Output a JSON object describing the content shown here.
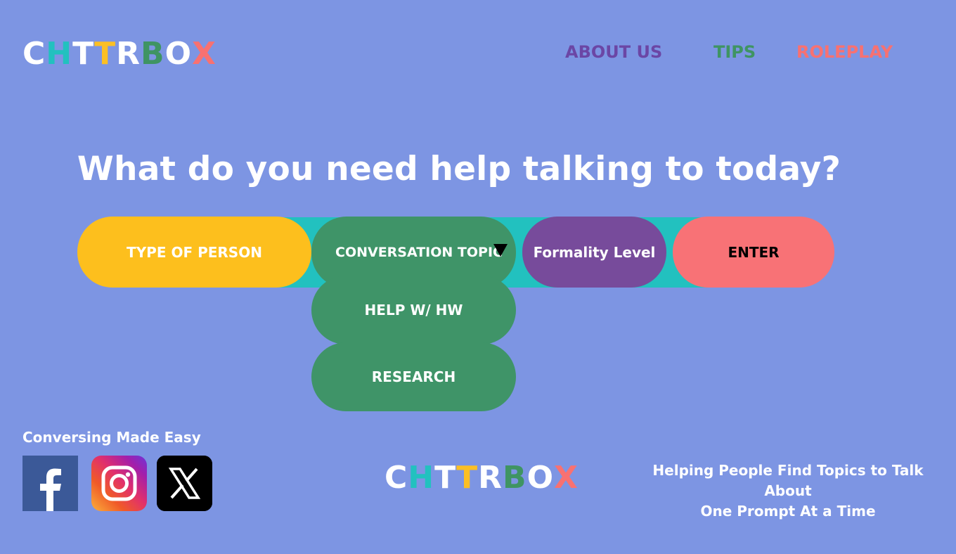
{
  "header": {
    "logo_letters": [
      {
        "char": "C",
        "color": "#ffffff"
      },
      {
        "char": "H",
        "color": "#22c1bf"
      },
      {
        "char": "T",
        "color": "#ffffff"
      },
      {
        "char": "T",
        "color": "#fbbf24"
      },
      {
        "char": "R",
        "color": "#ffffff"
      },
      {
        "char": "B",
        "color": "#3f9463"
      },
      {
        "char": "O",
        "color": "#ffffff"
      },
      {
        "char": "X",
        "color": "#f87171"
      }
    ],
    "nav": [
      {
        "label": "ABOUT US",
        "color": "#6b46a5"
      },
      {
        "label": "TIPS",
        "color": "#3f9463"
      },
      {
        "label": "ROLEPLAY",
        "color": "#f87171"
      }
    ]
  },
  "main": {
    "headline": "What do you need help talking to today?",
    "selectors": {
      "type_of_person": {
        "label": "TYPE OF PERSON",
        "color": "#fdbf1d"
      },
      "conversation_topic": {
        "label": "CONVERSATION TOPIC",
        "color": "#3f9468",
        "caret_icon": "triangle-down"
      },
      "formality_level": {
        "label": "Formality Level",
        "color": "#774b9b"
      },
      "enter": {
        "label": "ENTER",
        "color": "#f87276"
      },
      "track_color": "#22c1bf"
    },
    "dropdown_options": [
      {
        "label": "HELP W/ HW"
      },
      {
        "label": "RESEARCH"
      }
    ]
  },
  "footer": {
    "tagline": "Conversing Made Easy",
    "social_icons": [
      "facebook-icon",
      "instagram-icon",
      "x-icon"
    ],
    "slogan_line1": "Helping People Find Topics to Talk About",
    "slogan_line2": "One Prompt At a Time"
  },
  "colors": {
    "background": "#7d95e3",
    "text": "#ffffff"
  }
}
